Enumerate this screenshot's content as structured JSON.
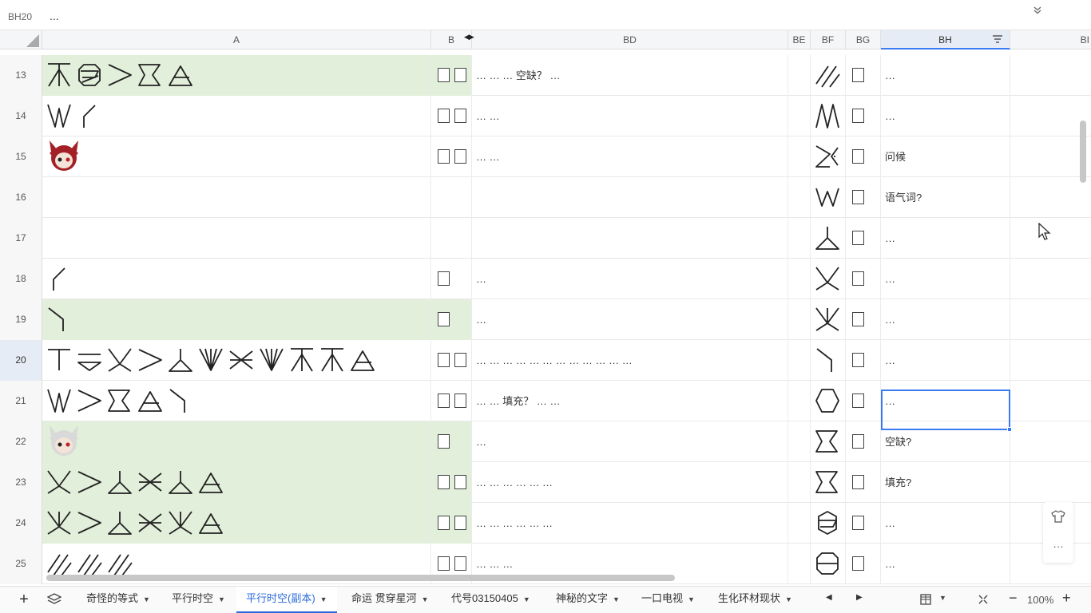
{
  "formula_bar": {
    "cell_ref": "BH20",
    "content": "..."
  },
  "columns": [
    {
      "id": "A",
      "label": "A"
    },
    {
      "id": "B",
      "label": "B"
    },
    {
      "id": "BD",
      "label": "BD"
    },
    {
      "id": "BE",
      "label": "BE"
    },
    {
      "id": "BF",
      "label": "BF"
    },
    {
      "id": "BG",
      "label": "BG"
    },
    {
      "id": "BH",
      "label": "BH"
    },
    {
      "id": "BI",
      "label": "BI"
    }
  ],
  "rows": [
    {
      "num": "13",
      "b_boxes": 2,
      "bd": "… … … 空缺？ …",
      "bh": "…",
      "green": true
    },
    {
      "num": "14",
      "b_boxes": 2,
      "bd": "… …",
      "bh": "…",
      "green": false
    },
    {
      "num": "15",
      "b_boxes": 2,
      "bd": "… …",
      "bh": "问候",
      "green": false
    },
    {
      "num": "16",
      "b_boxes": 0,
      "bd": "",
      "bh": "语气词?",
      "green": false
    },
    {
      "num": "17",
      "b_boxes": 0,
      "bd": "",
      "bh": "…",
      "green": false
    },
    {
      "num": "18",
      "b_boxes": 1,
      "bd": "…",
      "bh": "…",
      "green": false
    },
    {
      "num": "19",
      "b_boxes": 1,
      "bd": "…",
      "bh": "…",
      "green": true
    },
    {
      "num": "20",
      "b_boxes": 2,
      "bd": "… … … … … … … … … … … …",
      "bh": "…",
      "green": false,
      "active": true
    },
    {
      "num": "21",
      "b_boxes": 2,
      "bd": "… … 填充？ … …",
      "bh": "…",
      "green": false
    },
    {
      "num": "22",
      "b_boxes": 1,
      "bd": "…",
      "bh": "空缺?",
      "green": true
    },
    {
      "num": "23",
      "b_boxes": 2,
      "bd": "… … … … … …",
      "bh": "填充?",
      "green": true
    },
    {
      "num": "24",
      "b_boxes": 2,
      "bd": "… … … … … …",
      "bh": "…",
      "green": true
    },
    {
      "num": "25",
      "b_boxes": 2,
      "bd": "… … …",
      "bh": "…",
      "green": false
    }
  ],
  "sheet_tabs": [
    {
      "label": "奇怪的等式",
      "active": false
    },
    {
      "label": "平行时空",
      "active": false
    },
    {
      "label": "平行时空(副本)",
      "active": true
    },
    {
      "label": "命运 贯穿星河",
      "active": false
    },
    {
      "label": "代号03150405",
      "active": false
    },
    {
      "label": "神秘的文字",
      "active": false
    },
    {
      "label": "一口电视",
      "active": false
    },
    {
      "label": "生化环材现状",
      "active": false
    }
  ],
  "zoom": {
    "value": "100%"
  },
  "side_tools": {
    "more": "…"
  },
  "colors": {
    "accent": "#3a7af2",
    "row_green": "#e2efda"
  },
  "icons": [
    "add-icon",
    "layers-icon",
    "filter-icon",
    "shirt-icon",
    "grid-view-icon",
    "freeze-icon",
    "cursor-icon"
  ]
}
